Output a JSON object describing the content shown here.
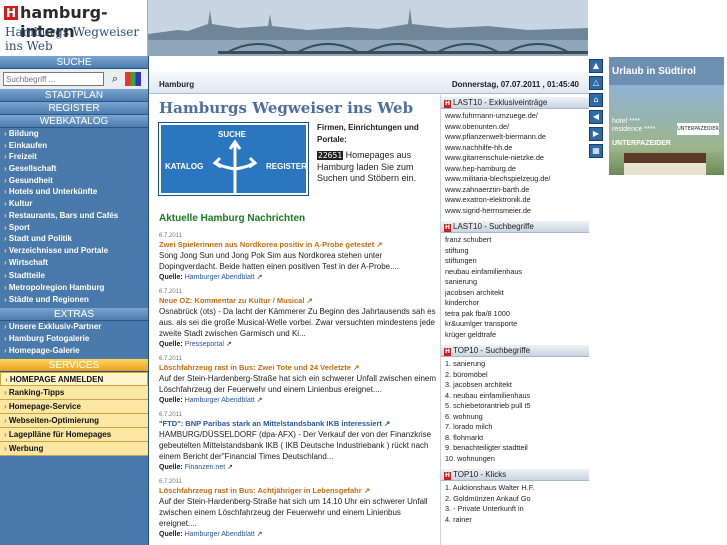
{
  "logo": {
    "letter": "H",
    "main": "hamburg-intern",
    "sub": "Hamburgs Wegweiser ins Web"
  },
  "left": {
    "search_head": "SUCHE",
    "search_placeholder": "Suchbegriff ...",
    "stadtplan": "STADTPLAN",
    "register": "REGISTER",
    "webkatalog": "WEBKATALOG",
    "catalog": [
      "Bildung",
      "Einkaufen",
      "Freizeit",
      "Gesellschaft",
      "Gesundheit",
      "Hotels und Unterkünfte",
      "Kultur",
      "Restaurants, Bars und Cafés",
      "Sport",
      "Stadt und Politik",
      "Verzeichnisse und Portale",
      "Wirtschaft",
      "Stadtteile",
      "Metropolregion Hamburg",
      "Städte und Regionen"
    ],
    "extras_head": "EXTRAS",
    "extras": [
      "Unsere Exklusiv-Partner",
      "Hamburg Fotogalerie",
      "Homepage-Galerie"
    ],
    "services_head": "SERVICES",
    "services": [
      "HOMEPAGE ANMELDEN",
      "Ranking-Tipps",
      "Homepage-Service",
      "Webseiten-Optimierung",
      "Lageplläne für Homepages",
      "Werbung"
    ]
  },
  "main": {
    "crumb": "Hamburg",
    "datetime": "Donnerstag, 07.07.2011 , 01:45:40",
    "title": "Hamburgs Wegweiser ins Web",
    "sign": {
      "suche": "SUCHE",
      "katalog": "KATALOG",
      "register": "REGISTER"
    },
    "intro_head": "Firmen, Einrichtungen und Portale:",
    "counter": "22651",
    "intro_body": " Homepages aus Hamburg laden Sie zum Suchen und Stöbern ein.",
    "news_title": "Aktuelle Hamburg Nachrichten",
    "news": [
      {
        "date": "6.7.2011",
        "title": "Zwei Spielerinnen aus Nordkorea positiv in A-Probe getestet",
        "text": "Song Jong Sun und Jong Pok Sim aus Nordkorea stehen unter Dopingverdacht. Beide hatten einen positiven Test in der A-Probe....",
        "source_label": "Quelle:",
        "source": "Hamburger Abendblatt"
      },
      {
        "date": "6.7.2011",
        "title": "Neue OZ: Kommentar zu Kultur / Musical",
        "text": "Osnabrück (ots) - Da lacht der Kämmerer Zu Beginn des Jahrtausends sah es aus. als sei die große Musical-Welle vorbei. Zwar versuchten mindestens jede zweite Stadt zwischen Garmisch und Ki...",
        "source_label": "Quelle:",
        "source": "Presseportal"
      },
      {
        "date": "6.7.2011",
        "title": "Löschfahrzeug rast in Bus: Zwei Tote und 24 Verletzte",
        "text": "Auf der Stein-Hardenberg-Straße hat sich ein schwerer Unfall zwischen einem Löschfahrzeug der Feuerwehr und einem Linienbus ereignet....",
        "source_label": "Quelle:",
        "source": "Hamburger Abendblatt"
      },
      {
        "date": "6.7.2011",
        "title": "\"FTD\": BNP Paribas stark an Mittelstandsbank IKB interessiert",
        "text": "HAMBURG/DÜSSELDORF (dpa-AFX) - Der Verkauf der von der Finanzkrise gebeutelten Mittelstandsbank IKB ( IKB Deutsche Industriebank ) rückt nach einem Bericht der\"Financial Times Deutschland...",
        "source_label": "Quelle:",
        "source": "Finanzen.net"
      },
      {
        "date": "6.7.2011",
        "title": "Löschfahrzeug rast in Bus: Achtjähriger in Lebensgefahr",
        "text": "Auf der Stein-Hardenberg-Straße hat sich um 14.10 Uhr ein schwerer Unfall zwischen einem Löschfahrzeug der Feuerwehr und einem Linienbus ereignet....",
        "source_label": "Quelle:",
        "source": "Hamburger Abendblatt"
      }
    ]
  },
  "right": {
    "last10_entries_head": "LAST10 - Exklusiveinträge",
    "last10_entries": [
      "www.fuhrmann-umzuege.de/",
      "www.obenunten.de/",
      "www.pflanzenwelt-biermann.de",
      "www.nachhilfe-hh.de",
      "www.gitarrenschule-nietzke.de",
      "www.hep-hamburg.de",
      "www.militaria-blechspielzeug.de/",
      "www.zahnaerztin-barth.de",
      "www.exatron-elektronik.de",
      "www.sigrid-herrnsmeier.de"
    ],
    "last10_search_head": "LAST10 - Suchbegriffe",
    "last10_search": [
      "franz schubert",
      "stiftung",
      "stiftungen",
      "neubau einfamilienhaus",
      "sanierung",
      "jacobsen architekt",
      "kinderchor",
      "tetra pak fba/8 1000",
      "kr&uumlger transporte",
      "krüger geldtrafe"
    ],
    "top10_search_head": "TOP10 - Suchbegriffe",
    "top10_search": [
      "sanierung",
      "büromöbel",
      "jacobsen architekt",
      "neubau einfamilienhaus",
      "schiebetorantrieb pull t5",
      "wohnung",
      "lorado milch",
      "flohmarkt",
      "benachteiligter stadtteil",
      "wohnungen"
    ],
    "top10_clicks_head": "TOP10 - Klicks",
    "top10_clicks": [
      "Auktionshaus Walter H.F.",
      "Goldmünzen Ankauf Go",
      "- Private Unterkunft in",
      "rainer"
    ]
  },
  "ad": {
    "title": "Urlaub in Südtirol",
    "hotel": "hotel ****\nresidence ****",
    "brand": "UNTERPAZEIDER",
    "logo": "UNTERPAZEIDER"
  },
  "colors": {
    "accent": "#4a7aab",
    "news_title": "#187b1d",
    "link": "#c86a10",
    "services": "#fbe7a2"
  }
}
